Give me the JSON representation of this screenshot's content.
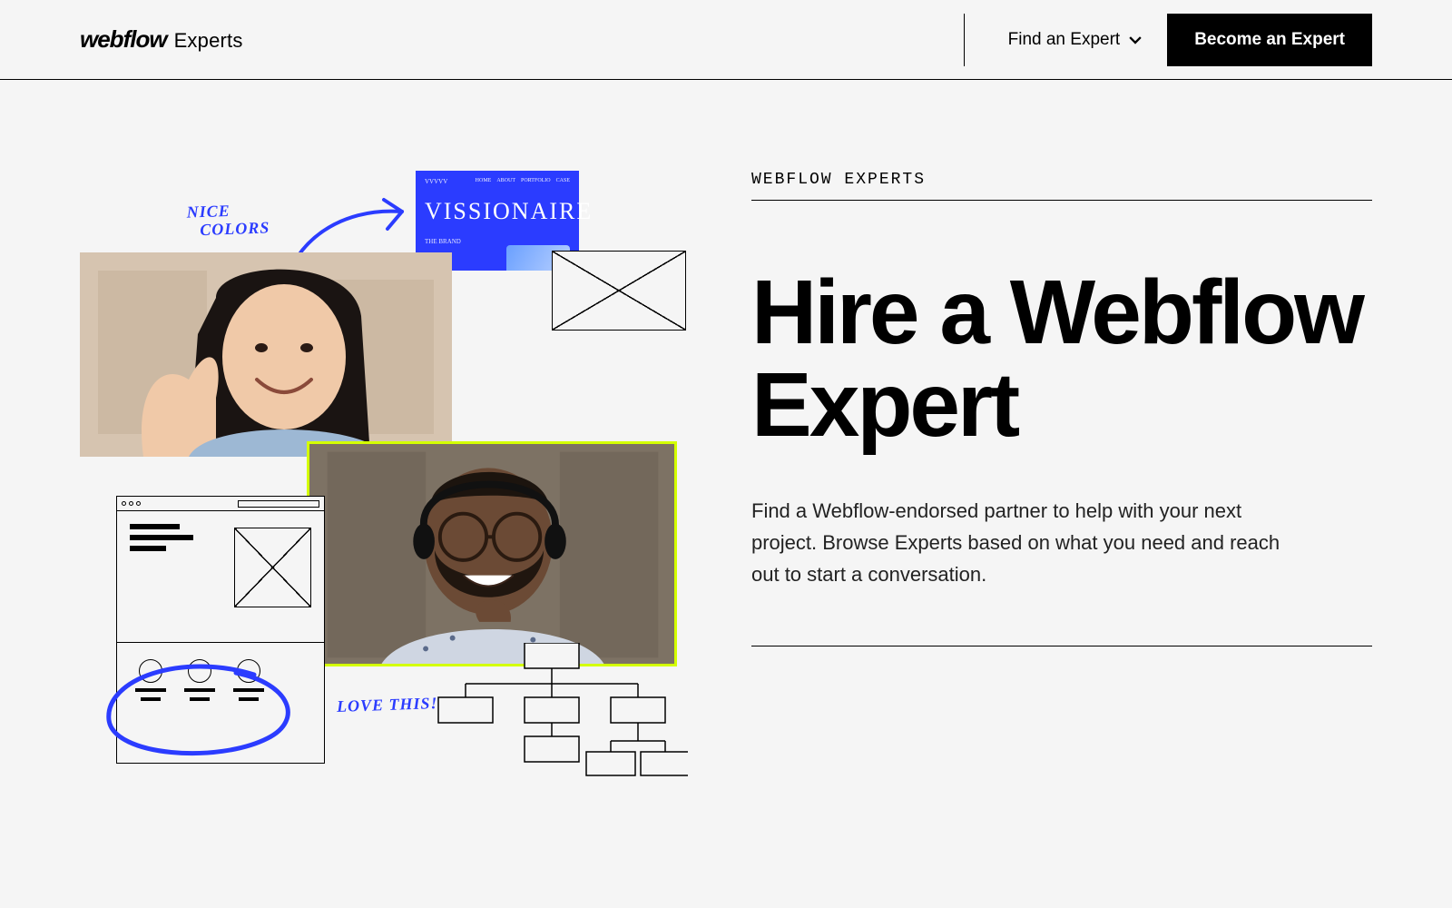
{
  "header": {
    "logo_word": "webflow",
    "logo_sub": "Experts",
    "find_label": "Find an Expert",
    "become_label": "Become an Expert"
  },
  "hero": {
    "eyebrow": "WEBFLOW EXPERTS",
    "title": "Hire a Webflow Expert",
    "body": "Find a Webflow-endorsed partner to help with your next project. Browse Experts based on what you need and reach out to start a conversation."
  },
  "collage": {
    "note_nice_line1": "NICE",
    "note_nice_line2": "COLORS",
    "note_love": "LOVE THIS!",
    "blue_card_text": "VISSIONAIRE"
  }
}
